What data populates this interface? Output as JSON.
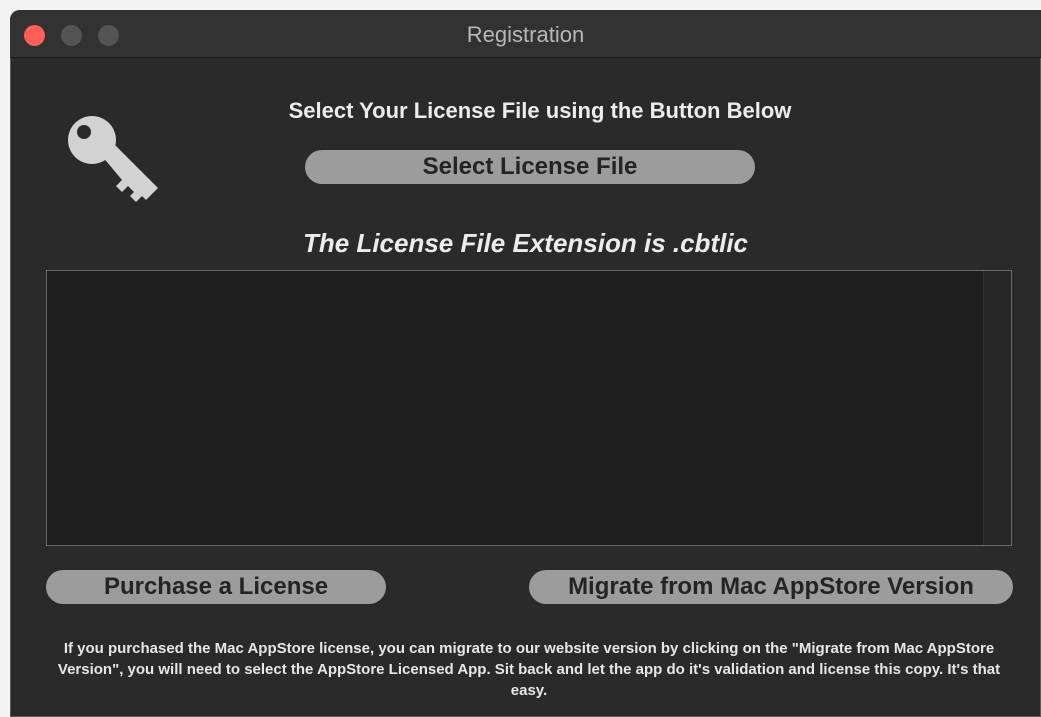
{
  "window": {
    "title": "Registration"
  },
  "icons": {
    "key": "key-icon"
  },
  "main": {
    "headline": "Select Your License File using the Button Below",
    "select_button_label": "Select License File",
    "extension_note": "The License File Extension is .cbtlic",
    "license_text": ""
  },
  "actions": {
    "purchase_label": "Purchase a License",
    "migrate_label": "Migrate from Mac AppStore Version"
  },
  "footer": {
    "note": "If you purchased the Mac AppStore license, you can migrate to our website version by clicking on the \"Migrate from Mac AppStore Version\", you will need to select the AppStore Licensed App. Sit back and let the app do it's validation and license this copy. It's that easy."
  },
  "colors": {
    "window_bg": "#2a2a2a",
    "button_bg": "#9c9c9c",
    "close_red": "#fe5f57"
  }
}
